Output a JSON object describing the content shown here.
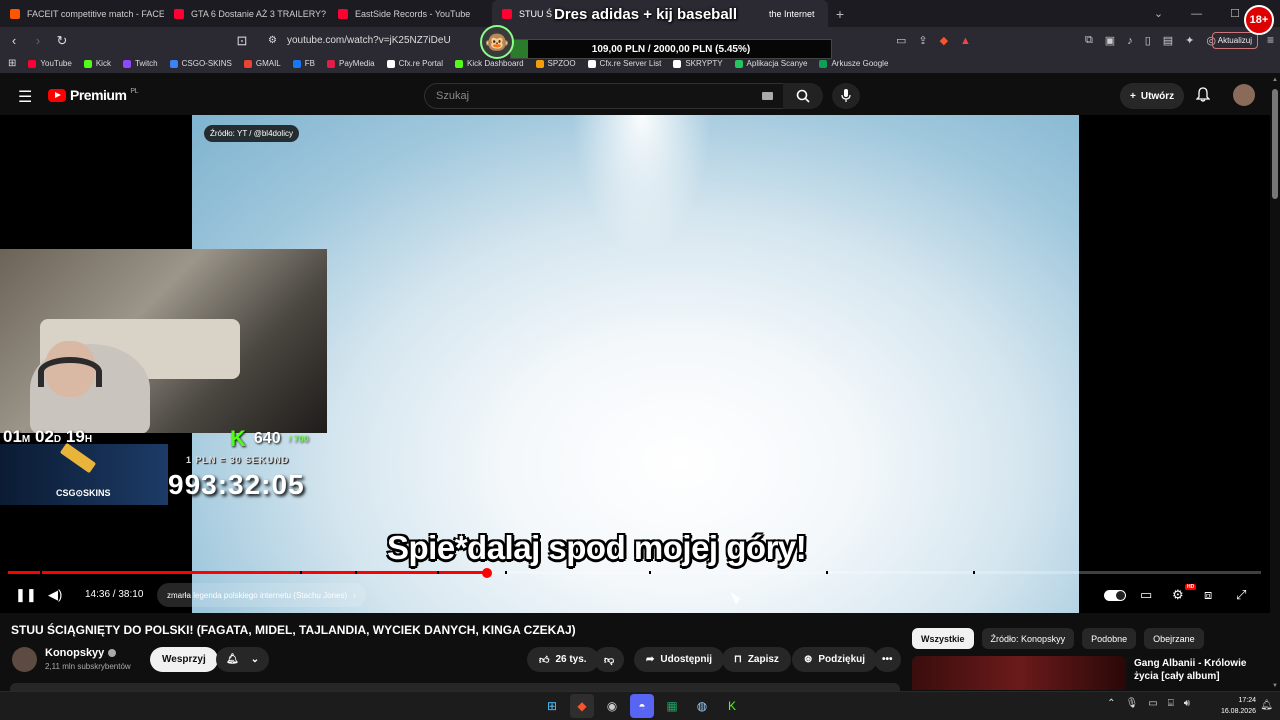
{
  "browser": {
    "tabs": [
      {
        "label": "FACEIT competitive match - FACEIT.c",
        "color": "#ff5500"
      },
      {
        "label": "GTA 6 Dostanie AŻ 3 TRAILERY? — R",
        "color": "#ff0033"
      },
      {
        "label": "EastSide Records - YouTube",
        "color": "#ff0033"
      },
      {
        "label": "STUU Ś",
        "color": "#ff0033",
        "active": true
      },
      {
        "label": "the Internet",
        "color": "#888888"
      }
    ],
    "url": "youtube.com/watch?v=jK25NZ7iDeU",
    "update_button": "Aktualizuj",
    "age_badge": "18+",
    "bookmarks": [
      {
        "label": "YouTube",
        "color": "#ff0033"
      },
      {
        "label": "Kick",
        "color": "#53fc18"
      },
      {
        "label": "Twitch",
        "color": "#9146ff"
      },
      {
        "label": "CSGO-SKINS",
        "color": "#3b82f6"
      },
      {
        "label": "GMAIL",
        "color": "#ea4335"
      },
      {
        "label": "FB",
        "color": "#1877f2"
      },
      {
        "label": "PayMedia",
        "color": "#e11d48"
      },
      {
        "label": "Cfx.re Portal",
        "color": "#ffffff"
      },
      {
        "label": "Kick Dashboard",
        "color": "#53fc18"
      },
      {
        "label": "SPZOO",
        "color": "#f59e0b"
      },
      {
        "label": "Cfx.re Server List",
        "color": "#ffffff"
      },
      {
        "label": "SKRYPTY",
        "color": "#ffffff"
      },
      {
        "label": "Aplikacja Scanye",
        "color": "#22c55e"
      },
      {
        "label": "Arkusze Google",
        "color": "#0f9d58"
      }
    ]
  },
  "stream_overlay": {
    "goal_title": "Dres adidas + kij baseball",
    "goal_text": "109,00 PLN / 2000,00 PLN  (5.45%)",
    "goal_progress": 0.0545,
    "countdown": {
      "months": "01",
      "m_unit": "M",
      "days": "02",
      "d_unit": "D",
      "hours": "19",
      "h_unit": "H"
    },
    "kick_count": "640",
    "kick_letter": "K",
    "kick_sub": "/ 700",
    "csgo_label": "CSG⊙SKINS",
    "rate_text": "1 PLN = 30 SEKUND",
    "big_timer": "993:32:05"
  },
  "youtube": {
    "logo_text": "Premium",
    "logo_region": "PL",
    "search_placeholder": "Szukaj",
    "create_label": "Utwórz",
    "player": {
      "source_tag": "Źródło: YT / @bl4dolicy",
      "subtitle": "Spie*dalaj spod mojej góry!",
      "time": "14:36 / 38:10",
      "played_fraction": 0.382,
      "chapter": "zmarła legenda polskiego internetu (Stachu Jones)",
      "hd_label": "HD"
    },
    "video_title": "STUU ŚCIĄGNIĘTY DO POLSKI! (FAGATA, MIDEL, TAJLANDIA, WYCIEK DANYCH, KINGA CZEKAJ)",
    "channel_name": "Konopskyy",
    "subscribers": "2,11 mln subskrybentów",
    "support_label": "Wesprzyj",
    "likes": "26 tys.",
    "share_label": "Udostępnij",
    "save_label": "Zapisz",
    "thanks_label": "Podziękuj",
    "chips": [
      "Wszystkie",
      "Źródło: Konopskyy",
      "Podobne",
      "Obejrzane"
    ],
    "recommended_title": "Gang Albanii - Królowie życia [cały album]"
  },
  "taskbar": {
    "time": "17:24",
    "date": "16.08.2026"
  }
}
